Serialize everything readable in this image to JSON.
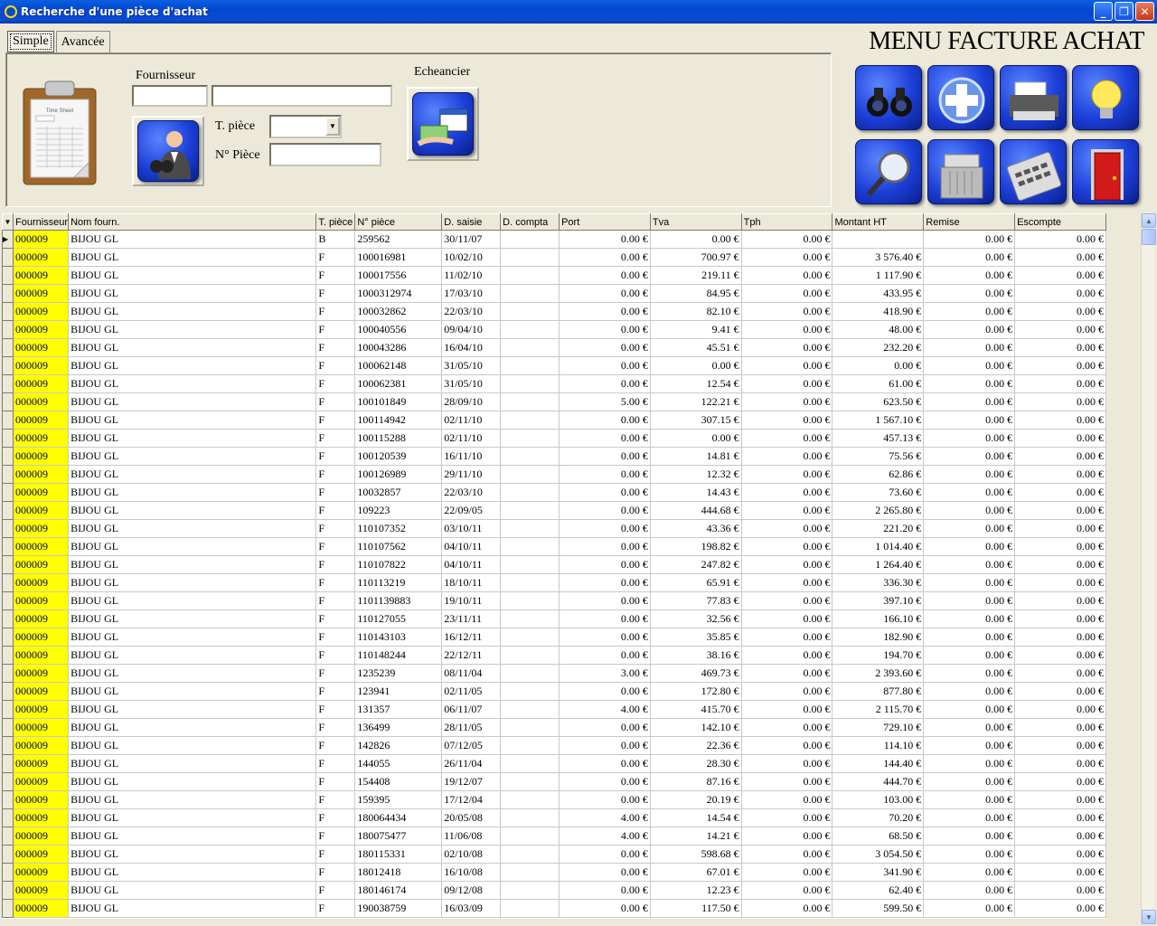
{
  "window": {
    "title": "Recherche d'une pièce d'achat",
    "minimize": "_",
    "maximize": "❐",
    "close": "✕"
  },
  "tabs": [
    {
      "label": "Simple"
    },
    {
      "label": "Avancée"
    }
  ],
  "form": {
    "fournisseur_label": "Fournisseur",
    "fournisseur_code": "",
    "fournisseur_name": "",
    "type_piece_label": "T. pièce",
    "type_piece_value": "",
    "num_piece_label": "N° Pièce",
    "num_piece_value": "",
    "echeancier_label": "Echeancier"
  },
  "menu_title": "MENU FACTURE ACHAT",
  "menu_icons": [
    "binoculars-icon",
    "add-plus-icon",
    "printer-icon",
    "lightbulb-icon",
    "magnifier-icon",
    "shredder-icon",
    "calculator-icon",
    "exit-door-icon"
  ],
  "grid": {
    "columns": [
      "Fournisseur",
      "Nom fourn.",
      "T. pièce",
      "N° pièce",
      "D. saisie",
      "D. compta",
      "Port",
      "Tva",
      "Tph",
      "Montant HT",
      "Remise",
      "Escompte"
    ],
    "rows": [
      [
        "000009",
        "BIJOU GL",
        "B",
        "259562",
        "30/11/07",
        "",
        "0.00 €",
        "0.00 €",
        "0.00 €",
        "",
        "0.00 €",
        "0.00 €"
      ],
      [
        "000009",
        "BIJOU GL",
        "F",
        "100016981",
        "10/02/10",
        "",
        "0.00 €",
        "700.97 €",
        "0.00 €",
        "3 576.40 €",
        "0.00 €",
        "0.00 €"
      ],
      [
        "000009",
        "BIJOU GL",
        "F",
        "100017556",
        "11/02/10",
        "",
        "0.00 €",
        "219.11 €",
        "0.00 €",
        "1 117.90 €",
        "0.00 €",
        "0.00 €"
      ],
      [
        "000009",
        "BIJOU GL",
        "F",
        "1000312974",
        "17/03/10",
        "",
        "0.00 €",
        "84.95 €",
        "0.00 €",
        "433.95 €",
        "0.00 €",
        "0.00 €"
      ],
      [
        "000009",
        "BIJOU GL",
        "F",
        "100032862",
        "22/03/10",
        "",
        "0.00 €",
        "82.10 €",
        "0.00 €",
        "418.90 €",
        "0.00 €",
        "0.00 €"
      ],
      [
        "000009",
        "BIJOU GL",
        "F",
        "100040556",
        "09/04/10",
        "",
        "0.00 €",
        "9.41 €",
        "0.00 €",
        "48.00 €",
        "0.00 €",
        "0.00 €"
      ],
      [
        "000009",
        "BIJOU GL",
        "F",
        "100043286",
        "16/04/10",
        "",
        "0.00 €",
        "45.51 €",
        "0.00 €",
        "232.20 €",
        "0.00 €",
        "0.00 €"
      ],
      [
        "000009",
        "BIJOU GL",
        "F",
        "100062148",
        "31/05/10",
        "",
        "0.00 €",
        "0.00 €",
        "0.00 €",
        "0.00 €",
        "0.00 €",
        "0.00 €"
      ],
      [
        "000009",
        "BIJOU GL",
        "F",
        "100062381",
        "31/05/10",
        "",
        "0.00 €",
        "12.54 €",
        "0.00 €",
        "61.00 €",
        "0.00 €",
        "0.00 €"
      ],
      [
        "000009",
        "BIJOU GL",
        "F",
        "100101849",
        "28/09/10",
        "",
        "5.00 €",
        "122.21 €",
        "0.00 €",
        "623.50 €",
        "0.00 €",
        "0.00 €"
      ],
      [
        "000009",
        "BIJOU GL",
        "F",
        "100114942",
        "02/11/10",
        "",
        "0.00 €",
        "307.15 €",
        "0.00 €",
        "1 567.10 €",
        "0.00 €",
        "0.00 €"
      ],
      [
        "000009",
        "BIJOU GL",
        "F",
        "100115288",
        "02/11/10",
        "",
        "0.00 €",
        "0.00 €",
        "0.00 €",
        "457.13 €",
        "0.00 €",
        "0.00 €"
      ],
      [
        "000009",
        "BIJOU GL",
        "F",
        "100120539",
        "16/11/10",
        "",
        "0.00 €",
        "14.81 €",
        "0.00 €",
        "75.56 €",
        "0.00 €",
        "0.00 €"
      ],
      [
        "000009",
        "BIJOU GL",
        "F",
        "100126989",
        "29/11/10",
        "",
        "0.00 €",
        "12.32 €",
        "0.00 €",
        "62.86 €",
        "0.00 €",
        "0.00 €"
      ],
      [
        "000009",
        "BIJOU GL",
        "F",
        "10032857",
        "22/03/10",
        "",
        "0.00 €",
        "14.43 €",
        "0.00 €",
        "73.60 €",
        "0.00 €",
        "0.00 €"
      ],
      [
        "000009",
        "BIJOU GL",
        "F",
        "109223",
        "22/09/05",
        "",
        "0.00 €",
        "444.68 €",
        "0.00 €",
        "2 265.80 €",
        "0.00 €",
        "0.00 €"
      ],
      [
        "000009",
        "BIJOU GL",
        "F",
        "110107352",
        "03/10/11",
        "",
        "0.00 €",
        "43.36 €",
        "0.00 €",
        "221.20 €",
        "0.00 €",
        "0.00 €"
      ],
      [
        "000009",
        "BIJOU GL",
        "F",
        "110107562",
        "04/10/11",
        "",
        "0.00 €",
        "198.82 €",
        "0.00 €",
        "1 014.40 €",
        "0.00 €",
        "0.00 €"
      ],
      [
        "000009",
        "BIJOU GL",
        "F",
        "110107822",
        "04/10/11",
        "",
        "0.00 €",
        "247.82 €",
        "0.00 €",
        "1 264.40 €",
        "0.00 €",
        "0.00 €"
      ],
      [
        "000009",
        "BIJOU GL",
        "F",
        "110113219",
        "18/10/11",
        "",
        "0.00 €",
        "65.91 €",
        "0.00 €",
        "336.30 €",
        "0.00 €",
        "0.00 €"
      ],
      [
        "000009",
        "BIJOU GL",
        "F",
        "1101139883",
        "19/10/11",
        "",
        "0.00 €",
        "77.83 €",
        "0.00 €",
        "397.10 €",
        "0.00 €",
        "0.00 €"
      ],
      [
        "000009",
        "BIJOU GL",
        "F",
        "110127055",
        "23/11/11",
        "",
        "0.00 €",
        "32.56 €",
        "0.00 €",
        "166.10 €",
        "0.00 €",
        "0.00 €"
      ],
      [
        "000009",
        "BIJOU GL",
        "F",
        "110143103",
        "16/12/11",
        "",
        "0.00 €",
        "35.85 €",
        "0.00 €",
        "182.90 €",
        "0.00 €",
        "0.00 €"
      ],
      [
        "000009",
        "BIJOU GL",
        "F",
        "110148244",
        "22/12/11",
        "",
        "0.00 €",
        "38.16 €",
        "0.00 €",
        "194.70 €",
        "0.00 €",
        "0.00 €"
      ],
      [
        "000009",
        "BIJOU GL",
        "F",
        "1235239",
        "08/11/04",
        "",
        "3.00 €",
        "469.73 €",
        "0.00 €",
        "2 393.60 €",
        "0.00 €",
        "0.00 €"
      ],
      [
        "000009",
        "BIJOU GL",
        "F",
        "123941",
        "02/11/05",
        "",
        "0.00 €",
        "172.80 €",
        "0.00 €",
        "877.80 €",
        "0.00 €",
        "0.00 €"
      ],
      [
        "000009",
        "BIJOU GL",
        "F",
        "131357",
        "06/11/07",
        "",
        "4.00 €",
        "415.70 €",
        "0.00 €",
        "2 115.70 €",
        "0.00 €",
        "0.00 €"
      ],
      [
        "000009",
        "BIJOU GL",
        "F",
        "136499",
        "28/11/05",
        "",
        "0.00 €",
        "142.10 €",
        "0.00 €",
        "729.10 €",
        "0.00 €",
        "0.00 €"
      ],
      [
        "000009",
        "BIJOU GL",
        "F",
        "142826",
        "07/12/05",
        "",
        "0.00 €",
        "22.36 €",
        "0.00 €",
        "114.10 €",
        "0.00 €",
        "0.00 €"
      ],
      [
        "000009",
        "BIJOU GL",
        "F",
        "144055",
        "26/11/04",
        "",
        "0.00 €",
        "28.30 €",
        "0.00 €",
        "144.40 €",
        "0.00 €",
        "0.00 €"
      ],
      [
        "000009",
        "BIJOU GL",
        "F",
        "154408",
        "19/12/07",
        "",
        "0.00 €",
        "87.16 €",
        "0.00 €",
        "444.70 €",
        "0.00 €",
        "0.00 €"
      ],
      [
        "000009",
        "BIJOU GL",
        "F",
        "159395",
        "17/12/04",
        "",
        "0.00 €",
        "20.19 €",
        "0.00 €",
        "103.00 €",
        "0.00 €",
        "0.00 €"
      ],
      [
        "000009",
        "BIJOU GL",
        "F",
        "180064434",
        "20/05/08",
        "",
        "4.00 €",
        "14.54 €",
        "0.00 €",
        "70.20 €",
        "0.00 €",
        "0.00 €"
      ],
      [
        "000009",
        "BIJOU GL",
        "F",
        "180075477",
        "11/06/08",
        "",
        "4.00 €",
        "14.21 €",
        "0.00 €",
        "68.50 €",
        "0.00 €",
        "0.00 €"
      ],
      [
        "000009",
        "BIJOU GL",
        "F",
        "180115331",
        "02/10/08",
        "",
        "0.00 €",
        "598.68 €",
        "0.00 €",
        "3 054.50 €",
        "0.00 €",
        "0.00 €"
      ],
      [
        "000009",
        "BIJOU GL",
        "F",
        "18012418",
        "16/10/08",
        "",
        "0.00 €",
        "67.01 €",
        "0.00 €",
        "341.90 €",
        "0.00 €",
        "0.00 €"
      ],
      [
        "000009",
        "BIJOU GL",
        "F",
        "180146174",
        "09/12/08",
        "",
        "0.00 €",
        "12.23 €",
        "0.00 €",
        "62.40 €",
        "0.00 €",
        "0.00 €"
      ],
      [
        "000009",
        "BIJOU GL",
        "F",
        "190038759",
        "16/03/09",
        "",
        "0.00 €",
        "117.50 €",
        "0.00 €",
        "599.50 €",
        "0.00 €",
        "0.00 €"
      ]
    ]
  }
}
